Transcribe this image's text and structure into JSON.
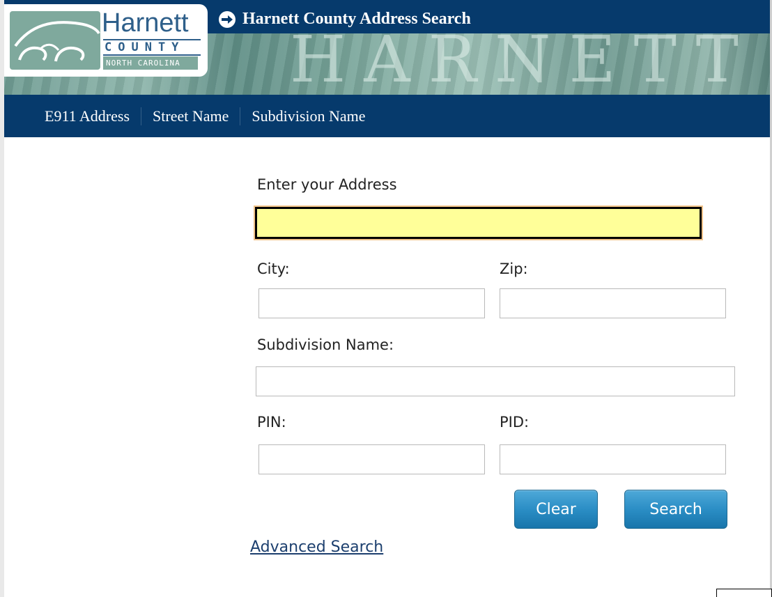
{
  "header": {
    "title": "Harnett County Address Search",
    "banner_word": "HARNETT",
    "logo": {
      "name": "Harnett",
      "county": "COUNTY",
      "state": "NORTH CAROLINA"
    }
  },
  "nav": {
    "items": [
      {
        "label": "E911 Address"
      },
      {
        "label": "Street Name"
      },
      {
        "label": "Subdivision Name"
      }
    ]
  },
  "form": {
    "address_label": "Enter your Address",
    "address_value": "",
    "city_label": "City:",
    "city_value": "",
    "zip_label": "Zip:",
    "zip_value": "",
    "subdivision_label": "Subdivision Name:",
    "subdivision_value": "",
    "pin_label": "PIN:",
    "pin_value": "",
    "pid_label": "PID:",
    "pid_value": "",
    "clear_label": "Clear",
    "search_label": "Search",
    "advanced_link": "Advanced Search"
  },
  "colors": {
    "header_bg": "#063a6c",
    "active_field_bg": "#ffff99",
    "button_blue": "#2b8ec5",
    "link": "#1c3f6e"
  }
}
